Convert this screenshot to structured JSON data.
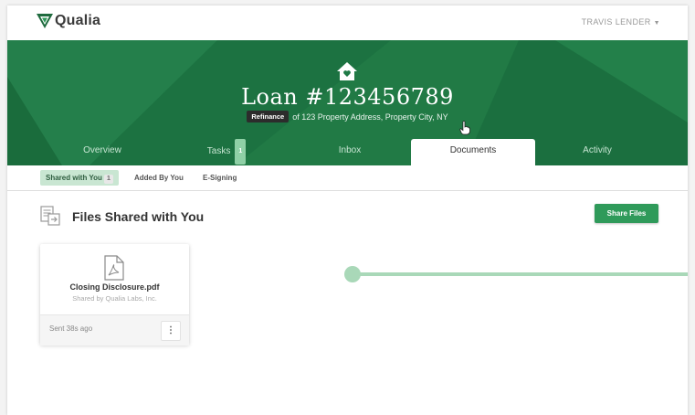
{
  "app": {
    "name": "Qualia"
  },
  "user": {
    "name": "TRAVIS LENDER"
  },
  "loan": {
    "title": "Loan #123456789",
    "type": "Refinance",
    "address": "of 123 Property Address, Property City, NY"
  },
  "tabs": [
    {
      "label": "Overview"
    },
    {
      "label": "Tasks",
      "badge": "1"
    },
    {
      "label": "Inbox"
    },
    {
      "label": "Documents",
      "active": true
    },
    {
      "label": "Activity"
    }
  ],
  "subtabs": [
    {
      "label": "Shared with You",
      "count": "1",
      "active": true
    },
    {
      "label": "Added By You"
    },
    {
      "label": "E-Signing"
    }
  ],
  "section": {
    "title": "Files Shared with You",
    "share_button": "Share Files"
  },
  "file": {
    "name": "Closing Disclosure.pdf",
    "shared_by": "Shared by Qualia Labs, Inc.",
    "sent": "Sent 38s ago"
  },
  "colors": {
    "brand": "#1f7a46",
    "accent": "#2f9a5a",
    "tab_active_bg": "#c9e6d2",
    "connector": "#a9d8b8"
  },
  "icons": [
    "qualia-logo-icon",
    "house-icon",
    "hand-cursor-icon",
    "files-icon",
    "pdf-file-icon",
    "kebab-menu-icon",
    "chevron-down-icon"
  ]
}
